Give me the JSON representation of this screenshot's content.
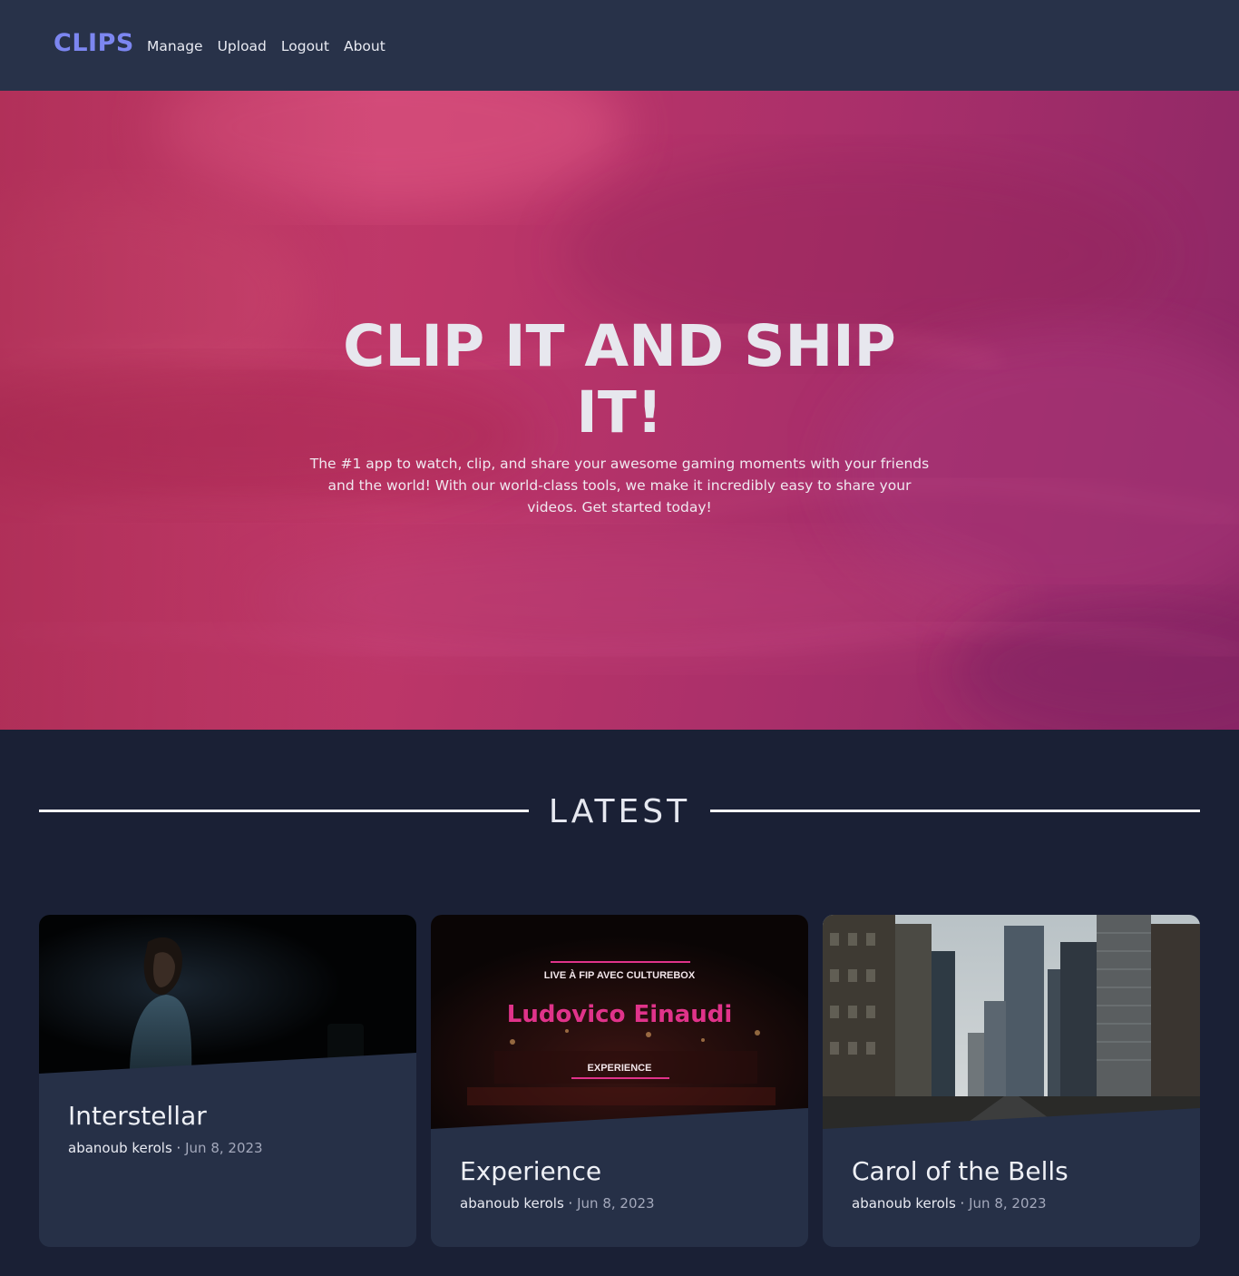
{
  "nav": {
    "brand": "CLIPS",
    "links": [
      {
        "label": "Manage"
      },
      {
        "label": "Upload"
      },
      {
        "label": "Logout"
      },
      {
        "label": "About"
      }
    ]
  },
  "hero": {
    "title": "CLIP IT AND SHIP IT!",
    "subtitle": "The #1 app to watch, clip, and share your awesome gaming moments with your friends and the world! With our world-class tools, we make it incredibly easy to share your videos. Get started today!"
  },
  "latest": {
    "heading": "LATEST"
  },
  "clips": [
    {
      "title": "Interstellar",
      "author": "abanoub kerols",
      "separator": "·",
      "date": "Jun 8, 2023"
    },
    {
      "title": "Experience",
      "author": "abanoub kerols",
      "separator": "·",
      "date": "Jun 8, 2023",
      "thumb_text": {
        "top": "LIVE À FIP AVEC CULTUREBOX",
        "name": "Ludovico Einaudi",
        "bottom": "EXPERIENCE"
      }
    },
    {
      "title": "Carol of the Bells",
      "author": "abanoub kerols",
      "separator": "·",
      "date": "Jun 8, 2023"
    }
  ],
  "colors": {
    "nav_bg": "#283249",
    "page_bg": "#1a2035",
    "brand": "#7c86f0",
    "card_bg": "#263047",
    "accent_pink": "#e0338a"
  }
}
